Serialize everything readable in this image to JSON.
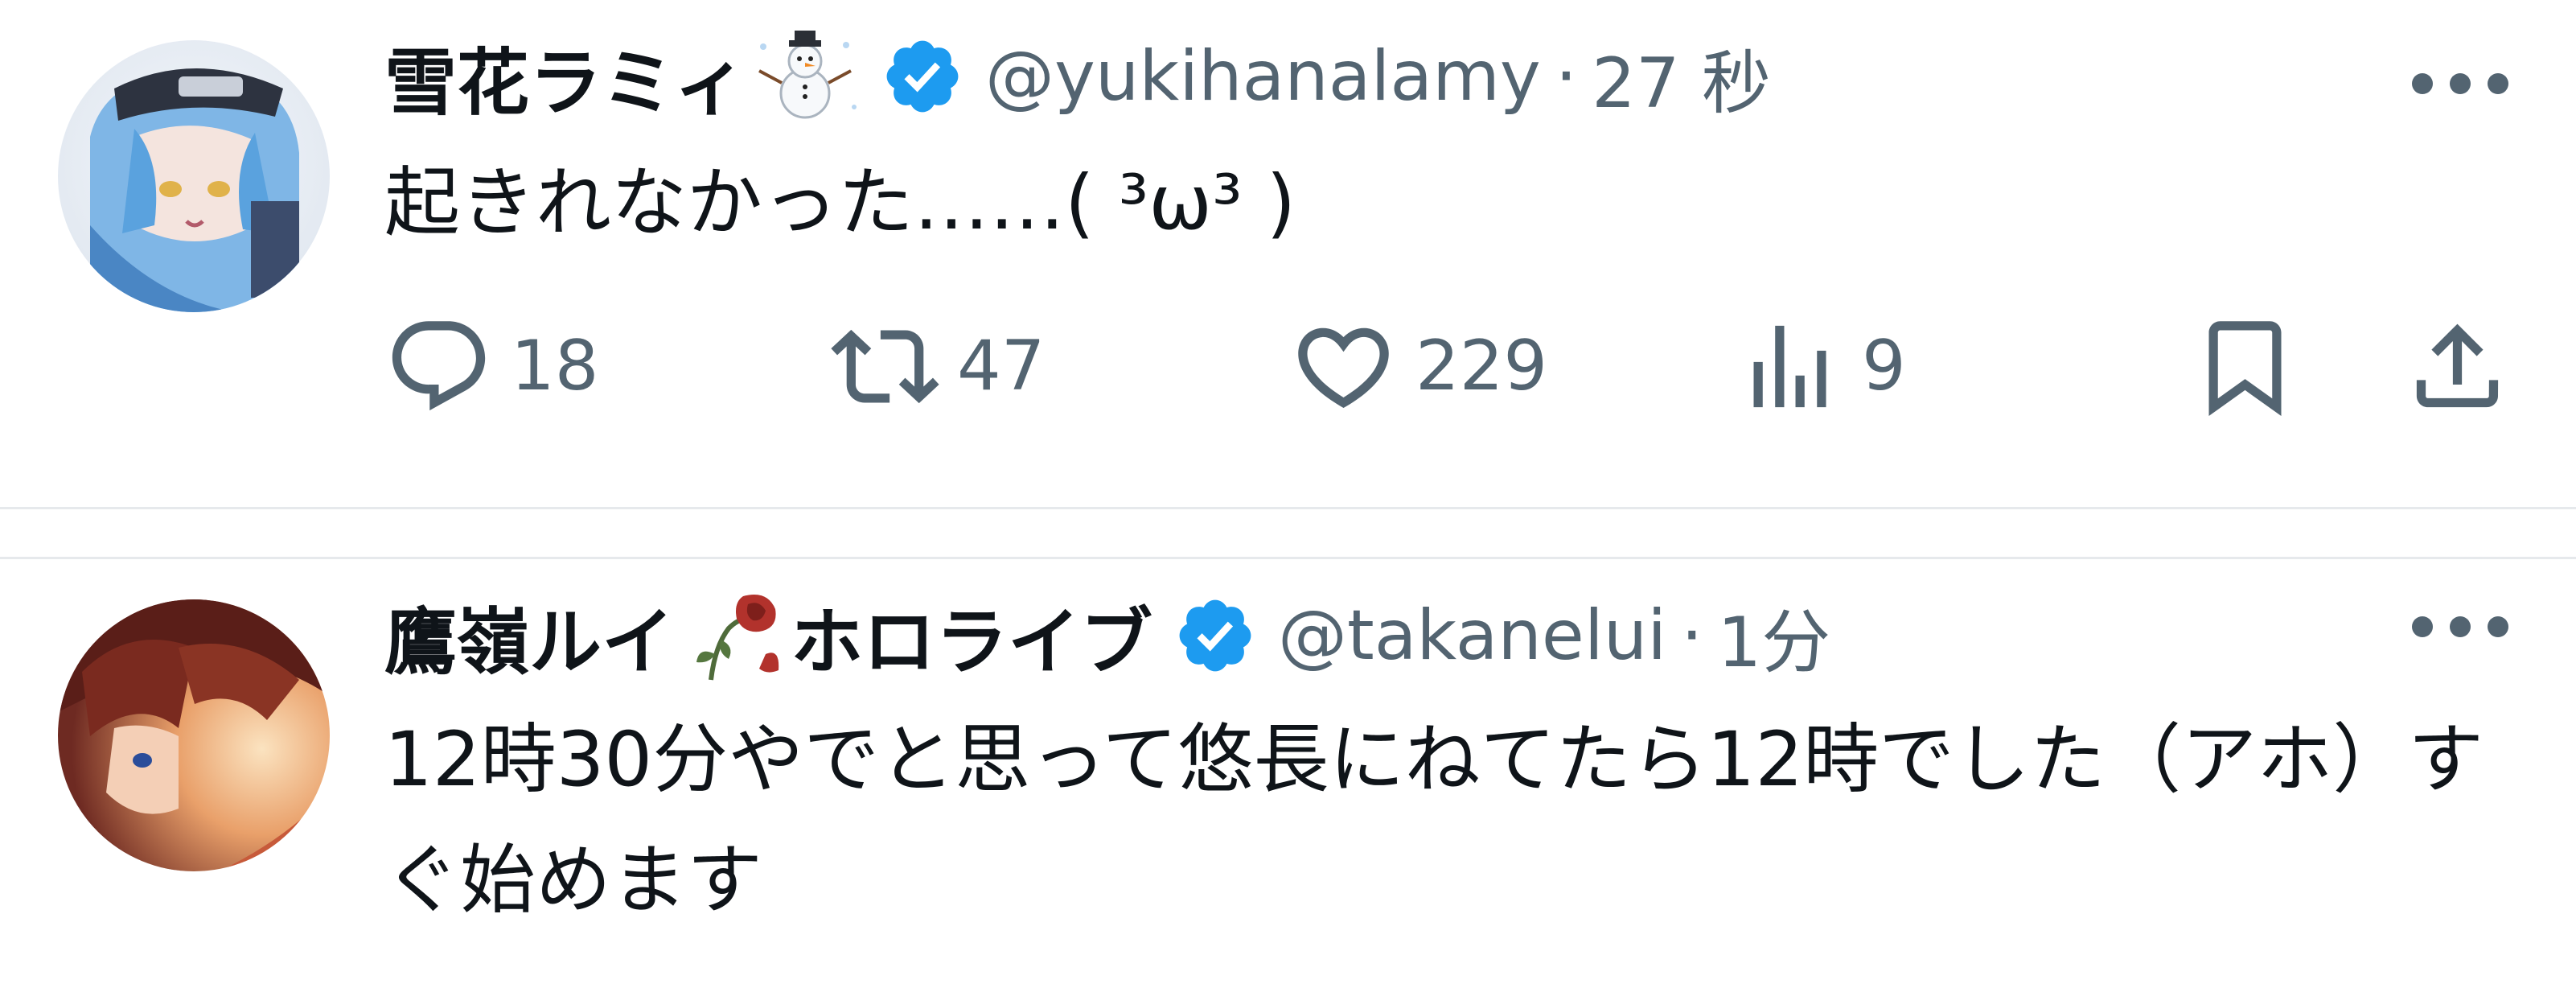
{
  "tweets": [
    {
      "display_name": "雪花ラミィ",
      "name_emoji": "snowman-icon",
      "name_suffix": "",
      "handle": "@yukihanalamy",
      "separator": "·",
      "time": "27 秒",
      "text": "起きれなかった……(  ³ω³  )",
      "stats": {
        "replies": "18",
        "retweets": "47",
        "likes": "229",
        "views": "9"
      }
    },
    {
      "display_name": "鷹嶺ルイ",
      "name_emoji": "wilted-rose-icon",
      "name_suffix": "ホロライブ",
      "handle": "@takanelui",
      "separator": "·",
      "time": "1分",
      "text": "12時30分やでと思って悠長にねてたら12時でした（アホ）すぐ始めます",
      "stats": {}
    }
  ],
  "colors": {
    "verified": "#1d9bf0",
    "secondary_text": "#536471",
    "divider": "#e6e9ec"
  }
}
